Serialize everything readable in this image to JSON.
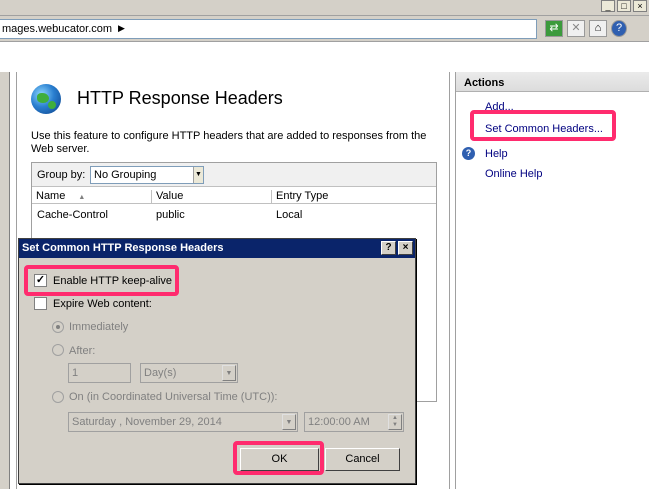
{
  "address": {
    "text": "mages.webucator.com",
    "arrow": "▶"
  },
  "window_buttons": [
    "_",
    "□",
    "×"
  ],
  "nav_icons": [
    "refresh-icon",
    "stop-icon",
    "home-icon",
    "help-icon"
  ],
  "nav_glyphs": [
    "⇄",
    "✕",
    "⌂",
    "?"
  ],
  "page": {
    "title": "HTTP Response Headers",
    "description": "Use this feature to configure HTTP headers that are added to responses from the Web server.",
    "group_by_label": "Group by:",
    "group_by_value": "No Grouping",
    "columns": [
      "Name",
      "Value",
      "Entry Type"
    ],
    "sort_glyph": "▲",
    "rows": [
      {
        "name": "Cache-Control",
        "value": "public",
        "entry_type": "Local"
      }
    ]
  },
  "actions": {
    "header": "Actions",
    "add": "Add...",
    "set_common": "Set Common Headers...",
    "help": "Help",
    "online_help": "Online Help"
  },
  "dialog": {
    "title": "Set Common HTTP Response Headers",
    "help_btn": "?",
    "close_btn": "×",
    "keepalive_label": "Enable HTTP keep-alive",
    "keepalive_checked": true,
    "expire_label": "Expire Web content:",
    "immediately_label": "Immediately",
    "after_label": "After:",
    "after_value": "1",
    "after_unit": "Day(s)",
    "on_label": "On (in Coordinated Universal Time (UTC)):",
    "date_value": "Saturday   , November 29, 2014",
    "time_value": "12:00:00 AM",
    "ok": "OK",
    "cancel": "Cancel"
  },
  "colors": {
    "highlight": "#ff2b6e",
    "dialog_title": "#0a246a",
    "link": "#000080"
  }
}
